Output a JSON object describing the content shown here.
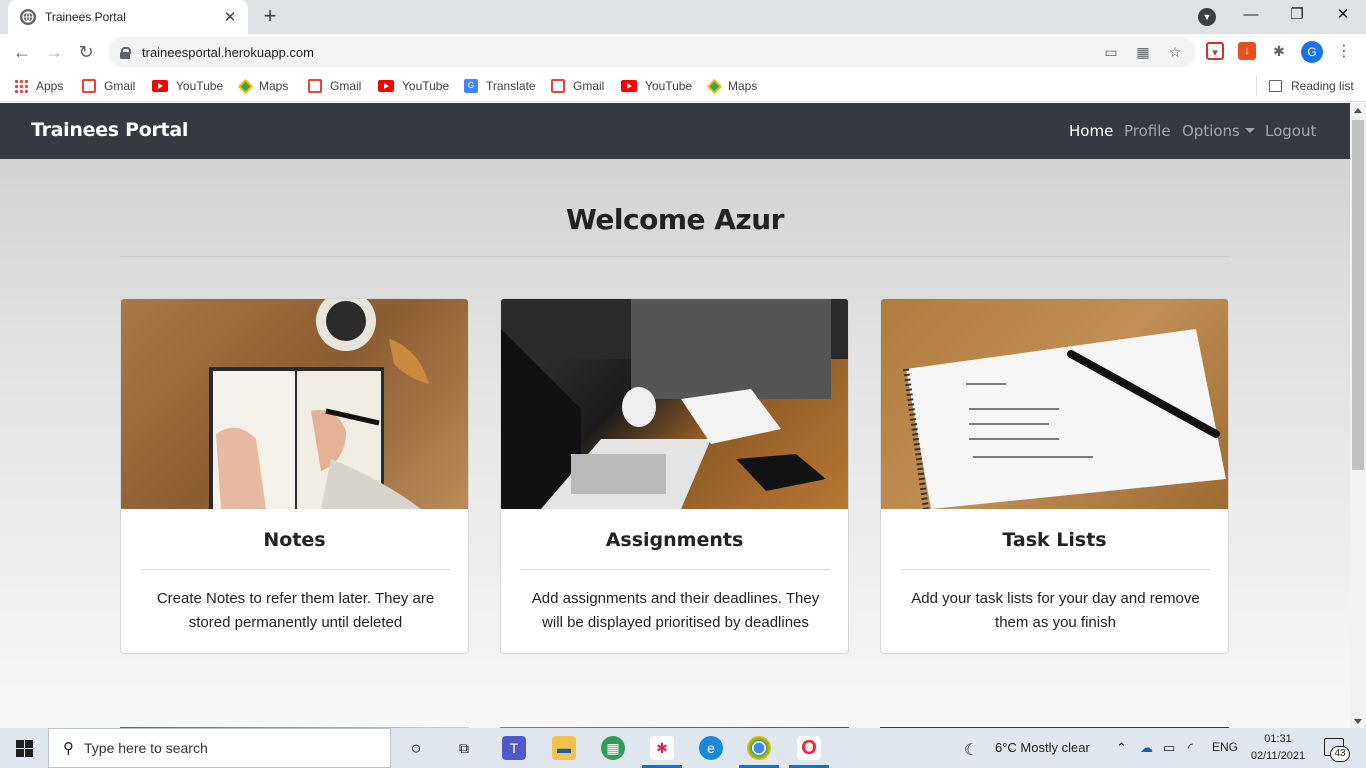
{
  "browser": {
    "tab_title": "Trainees Portal",
    "tab_close": "✕",
    "new_tab": "+",
    "url": "traineesportal.herokuapp.com",
    "profile_initial": "G",
    "window_controls": {
      "minimize": "—",
      "restore": "❐",
      "close": "✕"
    },
    "bookmarks": [
      {
        "label": "Apps",
        "icon": "apps-icon"
      },
      {
        "label": "Gmail",
        "icon": "gmail-icon"
      },
      {
        "label": "YouTube",
        "icon": "youtube-icon"
      },
      {
        "label": "Maps",
        "icon": "maps-icon"
      },
      {
        "label": "Gmail",
        "icon": "gmail-icon"
      },
      {
        "label": "YouTube",
        "icon": "youtube-icon"
      },
      {
        "label": "Translate",
        "icon": "translate-icon"
      },
      {
        "label": "Gmail",
        "icon": "gmail-icon"
      },
      {
        "label": "YouTube",
        "icon": "youtube-icon"
      },
      {
        "label": "Maps",
        "icon": "maps-icon"
      }
    ],
    "reading_list": "Reading list"
  },
  "navbar": {
    "brand": "Trainees Portal",
    "links": {
      "home": "Home",
      "profile": "Profile",
      "options": "Options",
      "logout": "Logout"
    }
  },
  "main": {
    "welcome": "Welcome Azur",
    "cards": [
      {
        "title": "Notes",
        "text": "Create Notes to refer them later. They are stored permanently until deleted"
      },
      {
        "title": "Assignments",
        "text": "Add assignments and their deadlines. They will be displayed prioritised by deadlines"
      },
      {
        "title": "Task Lists",
        "text": "Add your task lists for your day and remove them as you finish"
      }
    ]
  },
  "taskbar": {
    "search_placeholder": "Type here to search",
    "weather": "6°C  Mostly clear",
    "language": "ENG",
    "time": "01:31",
    "date": "02/11/2021",
    "notifications": "43"
  },
  "colors": {
    "navbar": "#343a40",
    "accent": "#0078d7"
  }
}
